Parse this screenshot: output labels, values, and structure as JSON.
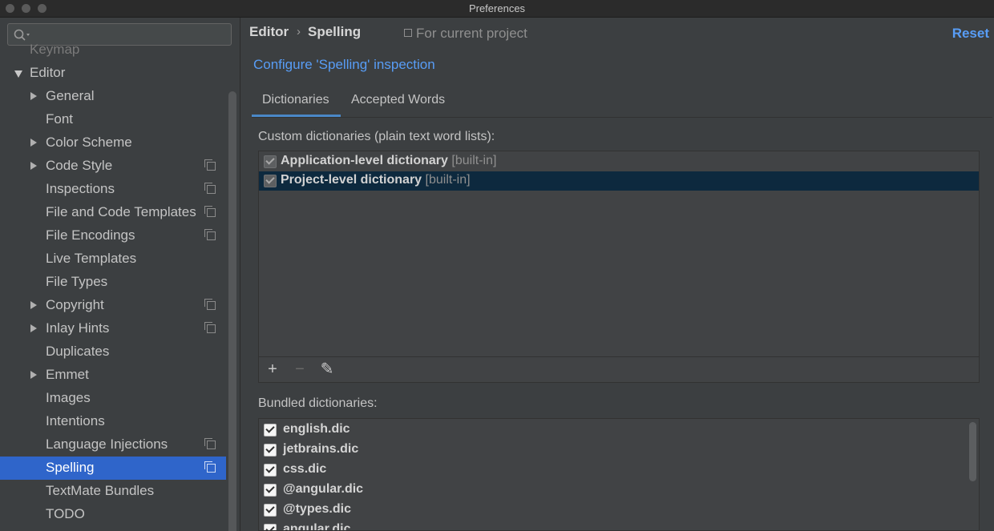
{
  "window": {
    "title": "Preferences"
  },
  "sidebar": {
    "search_placeholder": "",
    "items": [
      {
        "label": "Keymap",
        "expander": "none",
        "indent": 0,
        "copy_icon": false,
        "faded": true
      },
      {
        "label": "Editor",
        "expander": "expanded",
        "indent": 0,
        "copy_icon": false
      },
      {
        "label": "General",
        "expander": "collapsed",
        "indent": 1,
        "copy_icon": false
      },
      {
        "label": "Font",
        "expander": "none",
        "indent": 1,
        "copy_icon": false
      },
      {
        "label": "Color Scheme",
        "expander": "collapsed",
        "indent": 1,
        "copy_icon": false
      },
      {
        "label": "Code Style",
        "expander": "collapsed",
        "indent": 1,
        "copy_icon": true
      },
      {
        "label": "Inspections",
        "expander": "none",
        "indent": 1,
        "copy_icon": true
      },
      {
        "label": "File and Code Templates",
        "expander": "none",
        "indent": 1,
        "copy_icon": true
      },
      {
        "label": "File Encodings",
        "expander": "none",
        "indent": 1,
        "copy_icon": true
      },
      {
        "label": "Live Templates",
        "expander": "none",
        "indent": 1,
        "copy_icon": false
      },
      {
        "label": "File Types",
        "expander": "none",
        "indent": 1,
        "copy_icon": false
      },
      {
        "label": "Copyright",
        "expander": "collapsed",
        "indent": 1,
        "copy_icon": true
      },
      {
        "label": "Inlay Hints",
        "expander": "collapsed",
        "indent": 1,
        "copy_icon": true
      },
      {
        "label": "Duplicates",
        "expander": "none",
        "indent": 1,
        "copy_icon": false
      },
      {
        "label": "Emmet",
        "expander": "collapsed",
        "indent": 1,
        "copy_icon": false
      },
      {
        "label": "Images",
        "expander": "none",
        "indent": 1,
        "copy_icon": false
      },
      {
        "label": "Intentions",
        "expander": "none",
        "indent": 1,
        "copy_icon": false
      },
      {
        "label": "Language Injections",
        "expander": "none",
        "indent": 1,
        "copy_icon": true
      },
      {
        "label": "Spelling",
        "expander": "none",
        "indent": 1,
        "copy_icon": true,
        "selected": true
      },
      {
        "label": "TextMate Bundles",
        "expander": "none",
        "indent": 1,
        "copy_icon": false
      },
      {
        "label": "TODO",
        "expander": "none",
        "indent": 1,
        "copy_icon": false
      }
    ]
  },
  "header": {
    "breadcrumb": [
      "Editor",
      "Spelling"
    ],
    "breadcrumb_separator": "›",
    "scope": "For current project",
    "reset_label": "Reset"
  },
  "configure_link": "Configure 'Spelling' inspection",
  "tabs": [
    {
      "label": "Dictionaries",
      "active": true
    },
    {
      "label": "Accepted Words",
      "active": false
    }
  ],
  "custom": {
    "label": "Custom dictionaries (plain text word lists):",
    "rows": [
      {
        "name": "Application-level dictionary",
        "tag": "[built-in]",
        "checked": true,
        "selected": false
      },
      {
        "name": "Project-level dictionary",
        "tag": "[built-in]",
        "checked": true,
        "selected": true
      }
    ],
    "toolbar": {
      "add": "+",
      "remove": "−",
      "edit": "✎"
    }
  },
  "bundled": {
    "label": "Bundled dictionaries:",
    "rows": [
      {
        "name": "english.dic",
        "checked": true
      },
      {
        "name": "jetbrains.dic",
        "checked": true
      },
      {
        "name": "css.dic",
        "checked": true
      },
      {
        "name": "@angular.dic",
        "checked": true
      },
      {
        "name": "@types.dic",
        "checked": true
      },
      {
        "name": "angular.dic",
        "checked": true
      }
    ]
  },
  "colors": {
    "accent": "#2f65ca",
    "link": "#589df6",
    "background": "#3c3f41",
    "selected_row": "#0d293e"
  }
}
